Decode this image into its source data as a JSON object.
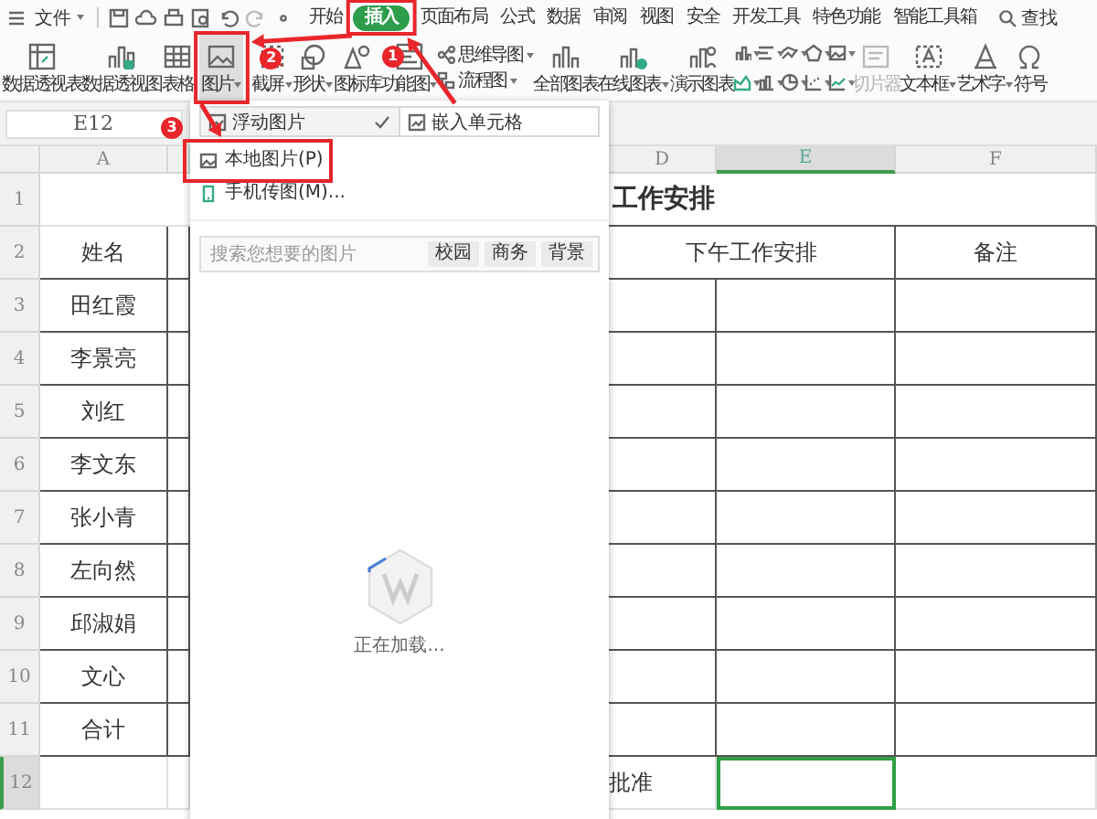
{
  "menu_bar": {
    "file_menu": "文件",
    "tabs": [
      {
        "label": "开始",
        "selected": false
      },
      {
        "label": "插入",
        "selected": true
      },
      {
        "label": "页面布局",
        "selected": false
      },
      {
        "label": "公式",
        "selected": false
      },
      {
        "label": "数据",
        "selected": false
      },
      {
        "label": "审阅",
        "selected": false
      },
      {
        "label": "视图",
        "selected": false
      },
      {
        "label": "安全",
        "selected": false
      },
      {
        "label": "开发工具",
        "selected": false
      },
      {
        "label": "特色功能",
        "selected": false
      },
      {
        "label": "智能工具箱",
        "selected": false
      }
    ],
    "search": "查找"
  },
  "ribbon": [
    {
      "kind": "large",
      "label": "数据透视表",
      "dropdown": false,
      "pressed": false,
      "disabled": false
    },
    {
      "kind": "large",
      "label": "数据透视图",
      "dropdown": false,
      "pressed": false,
      "disabled": false
    },
    {
      "kind": "large",
      "label": "表格",
      "dropdown": false,
      "pressed": false,
      "disabled": false
    },
    {
      "kind": "large",
      "label": "图片",
      "dropdown": true,
      "pressed": true,
      "disabled": false
    },
    {
      "kind": "large",
      "label": "截屏",
      "dropdown": true,
      "pressed": false,
      "disabled": false
    },
    {
      "kind": "large",
      "label": "形状",
      "dropdown": true,
      "pressed": false,
      "disabled": false
    },
    {
      "kind": "large",
      "label": "图标库",
      "dropdown": false,
      "pressed": false,
      "disabled": false
    },
    {
      "kind": "large",
      "label": "功能图",
      "dropdown": true,
      "pressed": false,
      "disabled": false
    },
    {
      "kind": "stack",
      "rows": [
        {
          "label": "思维导图",
          "dropdown": true
        },
        {
          "label": "流程图",
          "dropdown": true
        }
      ]
    },
    {
      "kind": "large",
      "label": "全部图表",
      "dropdown": false,
      "pressed": false,
      "disabled": false
    },
    {
      "kind": "large",
      "label": "在线图表",
      "dropdown": true,
      "pressed": false,
      "disabled": false
    },
    {
      "kind": "large",
      "label": "演示图表",
      "dropdown": false,
      "pressed": false,
      "disabled": false
    },
    {
      "kind": "chart_grid"
    },
    {
      "kind": "large",
      "label": "切片器",
      "dropdown": false,
      "pressed": false,
      "disabled": true
    },
    {
      "kind": "large",
      "label": "文本框",
      "dropdown": true,
      "pressed": false,
      "disabled": false
    },
    {
      "kind": "large",
      "label": "艺术字",
      "dropdown": true,
      "pressed": false,
      "disabled": false
    },
    {
      "kind": "large",
      "label": "符号",
      "dropdown": false,
      "pressed": false,
      "disabled": false
    }
  ],
  "sheet": {
    "name_box": "E12",
    "columns": [
      {
        "label": "A",
        "selected": false
      },
      {
        "label": "D",
        "selected": false
      },
      {
        "label": "E",
        "selected": true
      },
      {
        "label": "F",
        "selected": false
      }
    ],
    "rows": [
      {
        "header": "1",
        "kind": "title",
        "selected": false,
        "title": "工作安排"
      },
      {
        "header": "2",
        "kind": "head",
        "selected": false,
        "name": "姓名",
        "plan": "下午工作安排",
        "note": "备注"
      },
      {
        "header": "3",
        "kind": "data",
        "selected": false,
        "name": "田红霞"
      },
      {
        "header": "4",
        "kind": "data",
        "selected": false,
        "name": "李景亮"
      },
      {
        "header": "5",
        "kind": "data",
        "selected": false,
        "name": "刘红"
      },
      {
        "header": "6",
        "kind": "data",
        "selected": false,
        "name": "李文东"
      },
      {
        "header": "7",
        "kind": "data",
        "selected": false,
        "name": "张小青"
      },
      {
        "header": "8",
        "kind": "data",
        "selected": false,
        "name": "左向然"
      },
      {
        "header": "9",
        "kind": "data",
        "selected": false,
        "name": "邱淑娟"
      },
      {
        "header": "10",
        "kind": "data",
        "selected": false,
        "name": "文心"
      },
      {
        "header": "11",
        "kind": "data",
        "selected": false,
        "name": "合计"
      },
      {
        "header": "12",
        "kind": "sign",
        "selected": true,
        "label": "批准"
      }
    ]
  },
  "picture_menu": {
    "options": [
      {
        "label": "浮动图片",
        "selected": true
      },
      {
        "label": "嵌入单元格",
        "selected": false
      }
    ],
    "items": [
      "本地图片(P)",
      "手机传图(M)..."
    ],
    "search_placeholder": "搜索您想要的图片",
    "tags": [
      "校园",
      "商务",
      "背景"
    ],
    "loading": "正在加载..."
  },
  "annotations": [
    {
      "badge": "1"
    },
    {
      "badge": "2"
    },
    {
      "badge": "3"
    }
  ]
}
